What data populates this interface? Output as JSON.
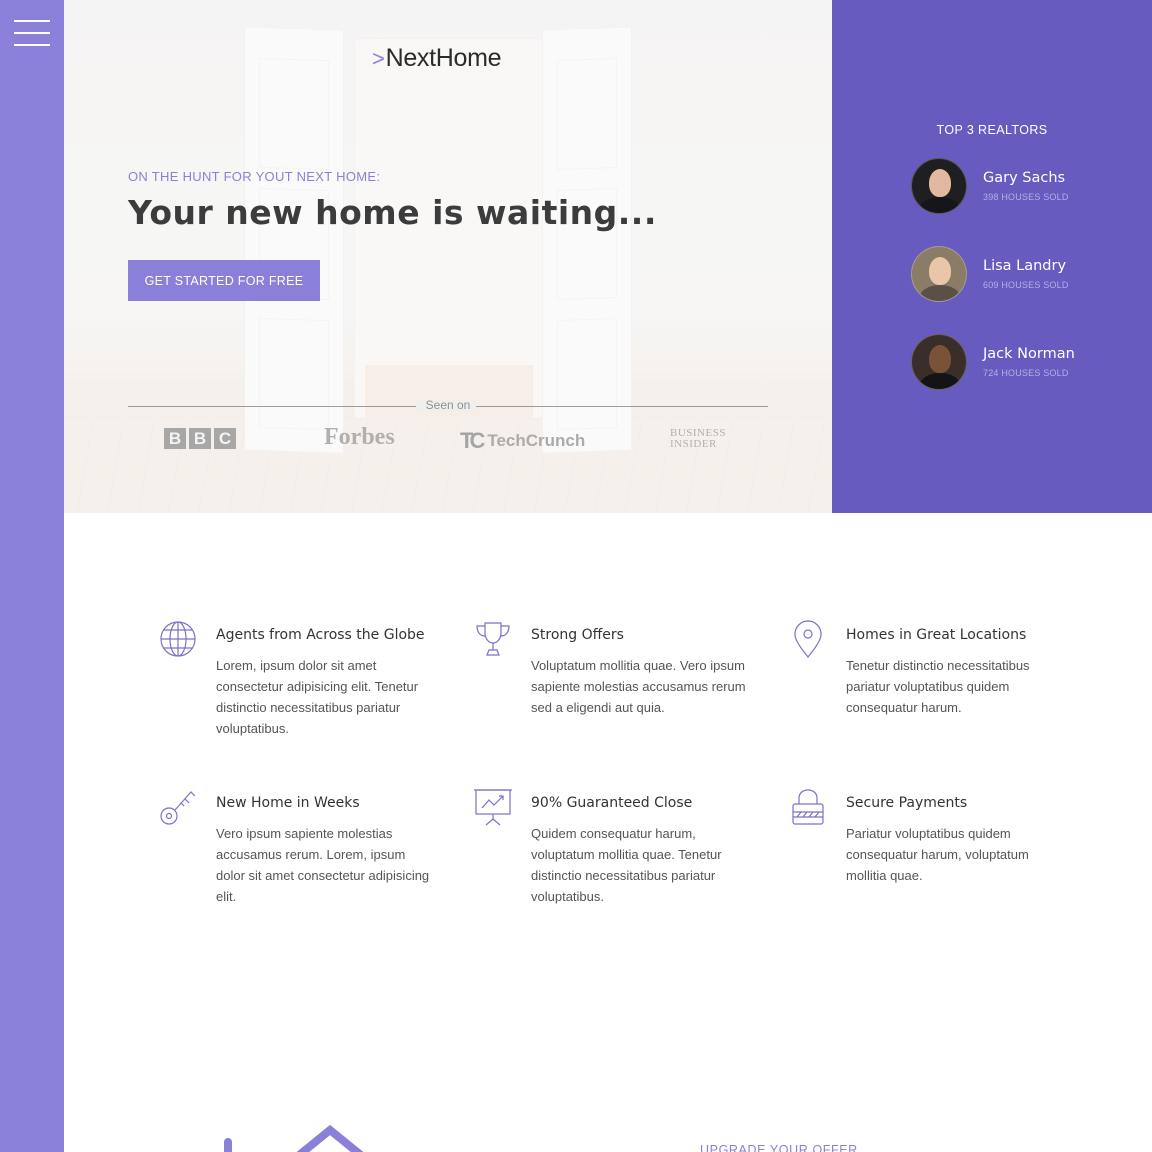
{
  "brand": {
    "logo_mark": ">",
    "logo_text": "NextHome",
    "accent": "#8b80d9",
    "panel": "#675bbf"
  },
  "hero": {
    "kicker": "ON THE HUNT FOR YOUT NEXT HOME:",
    "headline": "Your new home is waiting...",
    "cta_label": "GET STARTED FOR FREE",
    "seen_on_label": "Seen on",
    "press": [
      "BBC",
      "Forbes",
      "TechCrunch",
      "Business Insider"
    ]
  },
  "realtors": {
    "title": "TOP 3 REALTORS",
    "items": [
      {
        "name": "Gary Sachs",
        "sold": "398 HOUSES SOLD"
      },
      {
        "name": "Lisa Landry",
        "sold": "609 HOUSES SOLD"
      },
      {
        "name": "Jack Norman",
        "sold": "724 HOUSES SOLD"
      }
    ]
  },
  "features": [
    {
      "icon": "globe-icon",
      "title": "Agents from Across the Globe",
      "text": "Lorem, ipsum dolor sit amet consectetur adipisicing elit. Tenetur distinctio necessitatibus pariatur voluptatibus."
    },
    {
      "icon": "trophy-icon",
      "title": "Strong Offers",
      "text": "Voluptatum mollitia quae. Vero ipsum sapiente molestias accusamus rerum sed a eligendi aut quia."
    },
    {
      "icon": "map-pin-icon",
      "title": "Homes in Great Locations",
      "text": "Tenetur distinctio necessitatibus pariatur voluptatibus quidem consequatur harum."
    },
    {
      "icon": "key-icon",
      "title": "New Home in Weeks",
      "text": "Vero ipsum sapiente molestias accusamus rerum. Lorem, ipsum dolor sit amet consectetur adipisicing elit."
    },
    {
      "icon": "presentation-chart-icon",
      "title": "90% Guaranteed Close",
      "text": "Quidem consequatur harum, voluptatum mollitia quae. Tenetur distinctio necessitatibus pariatur voluptatibus."
    },
    {
      "icon": "padlock-icon",
      "title": "Secure Payments",
      "text": "Pariatur voluptatibus quidem consequatur harum, voluptatum mollitia quae."
    }
  ],
  "upgrade": {
    "label": "UPGRADE YOUR OFFER"
  }
}
